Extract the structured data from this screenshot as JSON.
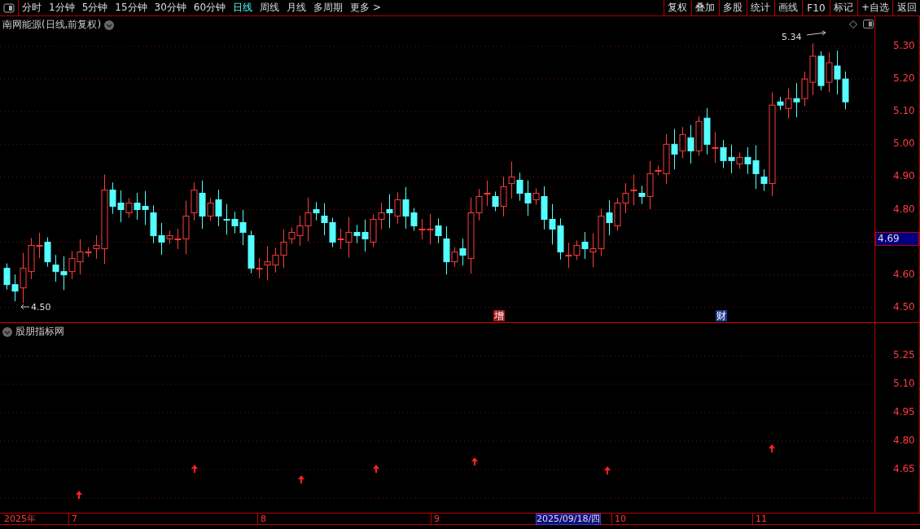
{
  "toolbar": {
    "periods": [
      {
        "label": "分时",
        "selected": false
      },
      {
        "label": "1分钟",
        "selected": false
      },
      {
        "label": "5分钟",
        "selected": false
      },
      {
        "label": "15分钟",
        "selected": false
      },
      {
        "label": "30分钟",
        "selected": false
      },
      {
        "label": "60分钟",
        "selected": false
      },
      {
        "label": "日线",
        "selected": true
      },
      {
        "label": "周线",
        "selected": false
      },
      {
        "label": "月线",
        "selected": false
      },
      {
        "label": "多周期",
        "selected": false
      },
      {
        "label": "更多 >",
        "selected": false
      }
    ],
    "buttons": [
      "复权",
      "叠加",
      "多股",
      "统计",
      "画线",
      "F10",
      "标记",
      "+自选",
      "返回"
    ]
  },
  "main_chart": {
    "title": "南网能源(日线,前复权)",
    "high_label": "5.34",
    "low_label": "4.50",
    "price_axis": [
      "5.30",
      "5.20",
      "5.10",
      "5.00",
      "4.90",
      "4.80",
      "4.60",
      "4.50"
    ],
    "current_price": "4.69",
    "events": [
      {
        "label": "增",
        "color": "#a01818"
      },
      {
        "label": "财",
        "color": "#1a3a8a"
      }
    ]
  },
  "indicator_panel": {
    "title": "股朋指标网",
    "axis": [
      "5.25",
      "5.10",
      "4.95",
      "4.80",
      "4.65"
    ]
  },
  "date_axis": {
    "labels": [
      "2025年",
      "7",
      "8",
      "9",
      "10",
      "11"
    ],
    "cursor_date": "2025/09/18/四"
  }
}
